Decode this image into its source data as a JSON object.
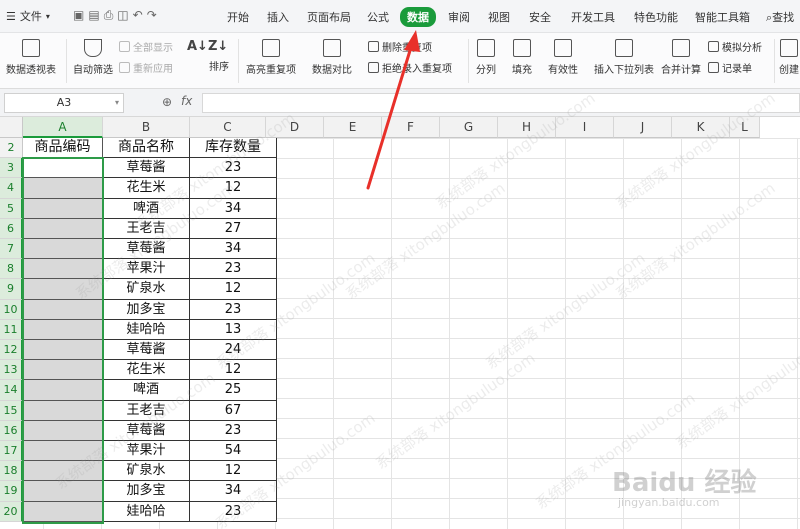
{
  "menu": {
    "file": "文件",
    "tabs": [
      "开始",
      "插入",
      "页面布局",
      "公式",
      "数据",
      "审阅",
      "视图",
      "安全",
      "开发工具",
      "特色功能",
      "智能工具箱"
    ],
    "active": "数据",
    "search": "查找"
  },
  "ribbon": {
    "pivot": "数据透视表",
    "autofilter": "自动筛选",
    "show_all": "全部显示",
    "reapply": "重新应用",
    "sort": "排序",
    "highlight_dup": "高亮重复项",
    "compare": "数据对比",
    "delete_dup": "删除重复项",
    "reject_dup": "拒绝录入重复项",
    "split": "分列",
    "fill": "填充",
    "validity": "有效性",
    "dropdown": "插入下拉列表",
    "consolidate": "合并计算",
    "simulate": "模拟分析",
    "record": "记录单",
    "create": "创建"
  },
  "formula_bar": {
    "cell_ref": "A3",
    "fx": "fx",
    "zoom_icon": "magnifier-icon"
  },
  "columns": [
    "A",
    "B",
    "C",
    "D",
    "E",
    "F",
    "G",
    "H",
    "I",
    "J",
    "K",
    "L"
  ],
  "rows": [
    "2",
    "3",
    "4",
    "5",
    "6",
    "7",
    "8",
    "9",
    "10",
    "11",
    "12",
    "13",
    "14",
    "15",
    "16",
    "17",
    "18",
    "19",
    "20"
  ],
  "table": {
    "headers": [
      "商品编码",
      "商品名称",
      "库存数量"
    ],
    "names": [
      "草莓酱",
      "花生米",
      "啤酒",
      "王老吉",
      "草莓酱",
      "苹果汁",
      "矿泉水",
      "加多宝",
      "娃哈哈",
      "草莓酱",
      "花生米",
      "啤酒",
      "王老吉",
      "草莓酱",
      "苹果汁",
      "矿泉水",
      "加多宝",
      "娃哈哈"
    ],
    "quantities": [
      "23",
      "12",
      "34",
      "27",
      "34",
      "23",
      "12",
      "23",
      "13",
      "24",
      "12",
      "25",
      "67",
      "23",
      "54",
      "12",
      "34",
      "23"
    ]
  },
  "watermark": "系统部落 xitongbuluo.com",
  "baidu_logo": "Baidu 经验",
  "baidu_url": "jingyan.baidu.com",
  "colors": {
    "accent": "#1a9b3b",
    "selection": "#2e9b48",
    "arrow": "#e8302a"
  }
}
